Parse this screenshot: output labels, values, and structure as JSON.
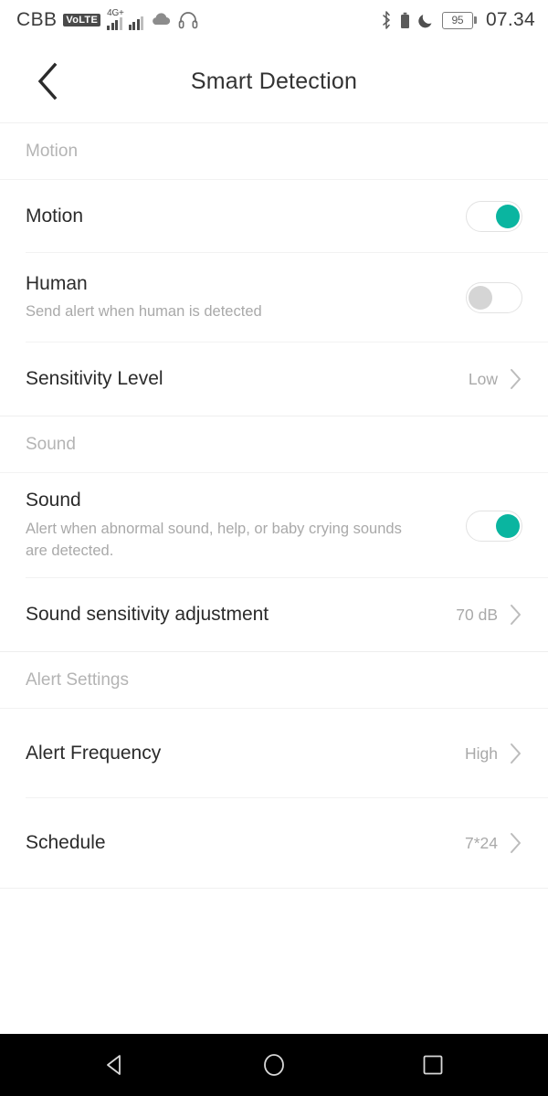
{
  "status_bar": {
    "carrier": "CBB",
    "volte_badge": "VoLTE",
    "network_type": "4G+",
    "battery_percent": "95",
    "time": "07.34",
    "icons": [
      "volte-icon",
      "signal-bars-icon",
      "cloud-icon",
      "headphones-icon",
      "bluetooth-icon",
      "battery-saver-icon",
      "do-not-disturb-moon-icon",
      "battery-icon"
    ]
  },
  "header": {
    "title": "Smart Detection",
    "back_icon": "back-chevron-icon"
  },
  "sections": [
    {
      "id": "motion",
      "header": "Motion",
      "rows": [
        {
          "id": "motion",
          "title": "Motion",
          "subtitle": "",
          "control": "toggle",
          "value": "on"
        },
        {
          "id": "human",
          "title": "Human",
          "subtitle": "Send alert when human is detected",
          "control": "toggle",
          "value": "off"
        },
        {
          "id": "sensitivity-level",
          "title": "Sensitivity Level",
          "subtitle": "",
          "control": "chevron",
          "value": "Low"
        }
      ]
    },
    {
      "id": "sound",
      "header": "Sound",
      "rows": [
        {
          "id": "sound",
          "title": "Sound",
          "subtitle": "Alert when abnormal sound, help, or baby crying sounds are detected.",
          "control": "toggle",
          "value": "on"
        },
        {
          "id": "sound-sensitivity-adjustment",
          "title": "Sound sensitivity adjustment",
          "subtitle": "",
          "control": "chevron",
          "value": "70 dB"
        }
      ]
    },
    {
      "id": "alert-settings",
      "header": "Alert Settings",
      "rows": [
        {
          "id": "alert-frequency",
          "title": "Alert Frequency",
          "subtitle": "",
          "control": "chevron",
          "value": "High"
        },
        {
          "id": "schedule",
          "title": "Schedule",
          "subtitle": "",
          "control": "chevron",
          "value": "7*24"
        }
      ]
    }
  ],
  "nav_bar": {
    "back": "nav-back-icon",
    "home": "nav-home-icon",
    "recents": "nav-recents-icon"
  },
  "colors": {
    "toggle_on": "#0ab5a0",
    "toggle_off_knob": "#d5d5d5",
    "title_text": "#333333",
    "section_header_text": "#b4b4b4",
    "value_text": "#a9a9a9",
    "nav_bar_bg": "#000000"
  }
}
